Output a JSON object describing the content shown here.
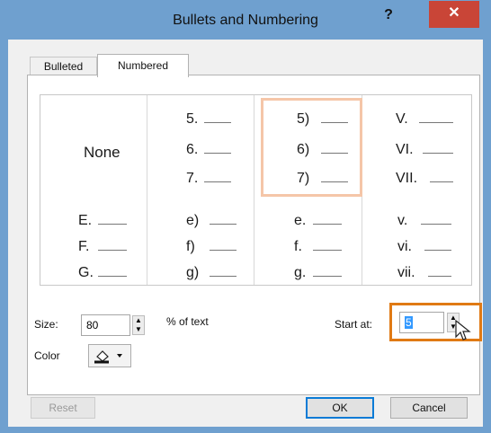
{
  "window": {
    "title": "Bullets and Numbering",
    "help": "?",
    "close": "✕"
  },
  "tabs": {
    "bulleted": "Bulleted",
    "numbered": "Numbered"
  },
  "gallery": {
    "none_label": "None",
    "row1": [
      [
        "5.",
        "6.",
        "7."
      ],
      [
        "5)",
        "6)",
        "7)"
      ],
      [
        "V.",
        "VI.",
        "VII."
      ]
    ],
    "row2": [
      [
        "E.",
        "F.",
        "G."
      ],
      [
        "e)",
        "f)",
        "g)"
      ],
      [
        "e.",
        "f.",
        "g."
      ],
      [
        "v.",
        "vi.",
        "vii."
      ]
    ]
  },
  "size": {
    "label": "Size:",
    "value": "80",
    "suffix": "% of text"
  },
  "start_at": {
    "label": "Start at:",
    "value": "5"
  },
  "color": {
    "label": "Color"
  },
  "buttons": {
    "reset": "Reset",
    "ok": "OK",
    "cancel": "Cancel"
  },
  "colors": {
    "titlebar": "#6fa0cf",
    "close": "#c94537",
    "highlight": "#e07a14",
    "selection": "#f5c6a8"
  },
  "icons": {
    "paint_bucket": "paint-bucket-icon",
    "dropdown": "chevron-down-icon",
    "spinner": "spinner-arrows-icon",
    "cursor": "mouse-pointer-icon"
  }
}
